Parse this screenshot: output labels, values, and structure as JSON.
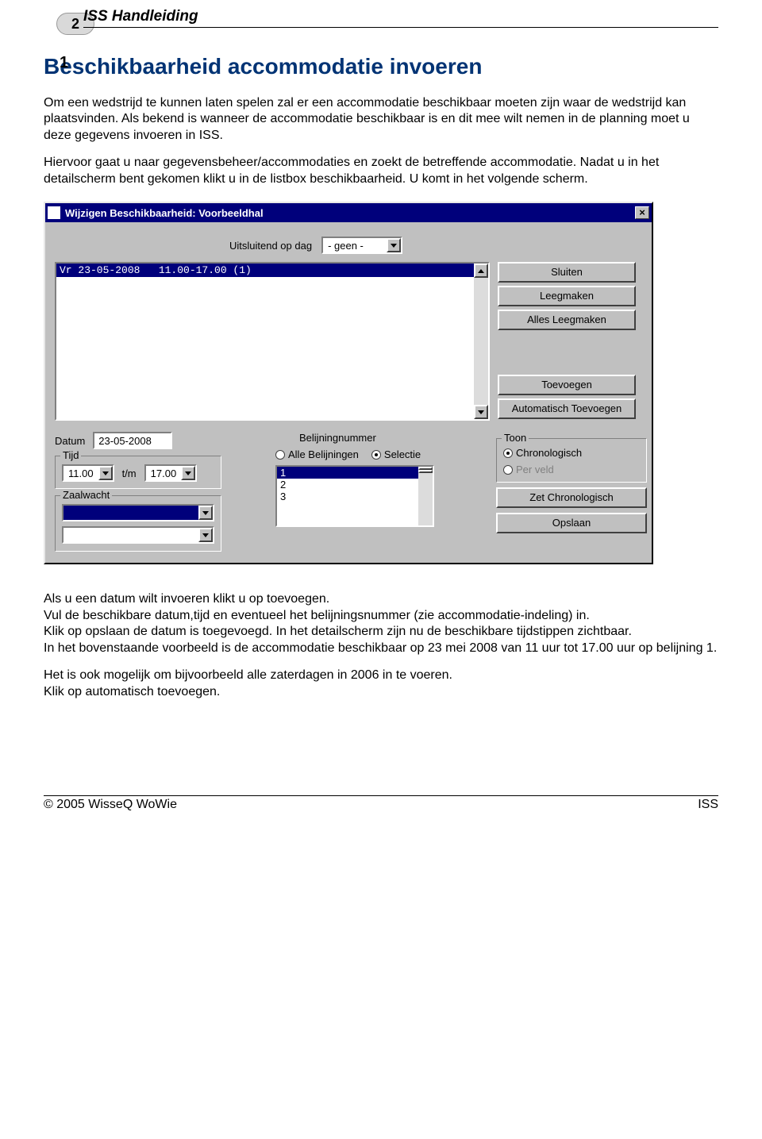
{
  "pageNumber": "2",
  "docTitle": "ISS Handleiding",
  "sectionNumber": "1",
  "sectionTitle": "Beschikbaarheid accommodatie invoeren",
  "para1": "Om een wedstrijd te kunnen laten spelen zal er een accommodatie beschikbaar moeten zijn waar de wedstrijd kan plaatsvinden.",
  "para2": "Als bekend is wanneer de accommodatie beschikbaar is en dit mee wilt nemen in de planning moet u deze gegevens invoeren in ISS.",
  "para3": "Hiervoor gaat u naar gegevensbeheer/accommodaties en zoekt de betreffende accommodatie. Nadat u in het detailscherm bent gekomen klikt u in de listbox beschikbaarheid. U komt in het volgende scherm.",
  "win": {
    "title": "Wijzigen Beschikbaarheid: Voorbeeldhal",
    "closeGlyph": "×",
    "dayLabel": "Uitsluitend op dag",
    "daySelected": "- geen -",
    "listItem": "Vr 23-05-2008   11.00-17.00 (1)",
    "buttons": {
      "sluiten": "Sluiten",
      "leegmaken": "Leegmaken",
      "allesLeegmaken": "Alles Leegmaken",
      "toevoegen": "Toevoegen",
      "autoToevoegen": "Automatisch Toevoegen",
      "zetChrono": "Zet Chronologisch",
      "opslaan": "Opslaan"
    },
    "datumLabel": "Datum",
    "datumValue": "23-05-2008",
    "tijdLegend": "Tijd",
    "tijdFrom": "11.00",
    "tijdSep": "t/m",
    "tijdTo": "17.00",
    "zaalLegend": "Zaalwacht",
    "belLabel": "Belijningnummer",
    "belRadio1": "Alle Belijningen",
    "belRadio2": "Selectie",
    "belItems": [
      "1",
      "2",
      "3"
    ],
    "toonLegend": "Toon",
    "toonRadio1": "Chronologisch",
    "toonRadio2": "Per veld"
  },
  "after": [
    "Als u een datum wilt invoeren klikt u op toevoegen.",
    "Vul de beschikbare datum,tijd en eventueel het belijningsnummer (zie accommodatie-indeling) in.",
    "Klik op opslaan de datum is toegevoegd. In het detailscherm zijn nu de beschikbare tijdstippen zichtbaar.",
    "In het bovenstaande voorbeeld is de accommodatie beschikbaar op 23 mei 2008 van 11 uur tot 17.00 uur op belijning 1.",
    "Het is ook mogelijk om bijvoorbeeld alle zaterdagen in 2006 in te voeren.",
    "Klik op automatisch toevoegen."
  ],
  "footerLeft": "© 2005 WisseQ WoWie",
  "footerRight": "ISS"
}
